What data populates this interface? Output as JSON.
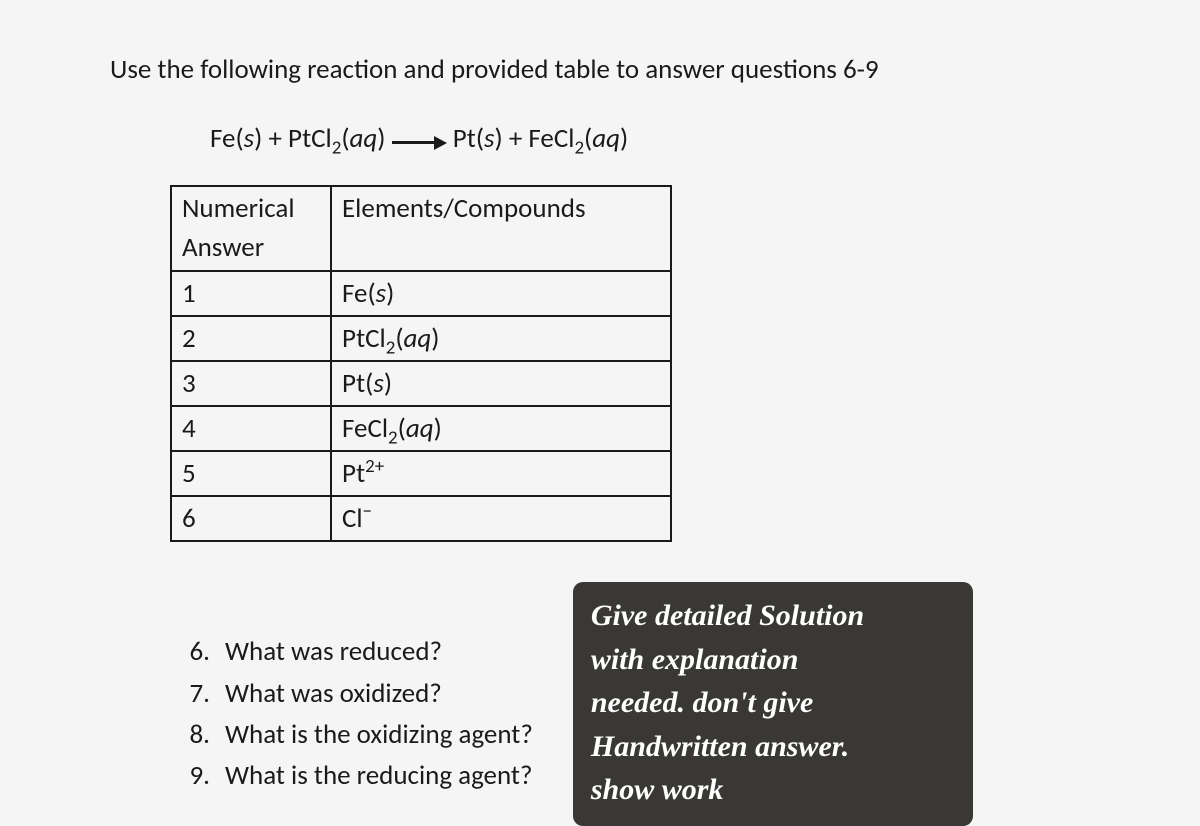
{
  "intro": "Use the following reaction and provided table to answer questions 6-9",
  "reaction": {
    "lhs1_el": "Fe",
    "lhs1_state": "s",
    "plus1": " + ",
    "lhs2_el": "PtCl",
    "lhs2_sub": "2",
    "lhs2_state": "aq",
    "rhs1_el": "Pt",
    "rhs1_state": "s",
    "plus2": " + ",
    "rhs2_el": "FeCl",
    "rhs2_sub": "2",
    "rhs2_state": "aq"
  },
  "table": {
    "header_col1": "Numerical Answer",
    "header_col2": "Elements/Compounds",
    "rows": [
      {
        "num": "1",
        "el": "Fe",
        "sub": "",
        "state": "s",
        "charge": ""
      },
      {
        "num": "2",
        "el": "PtCl",
        "sub": "2",
        "state": "aq",
        "charge": ""
      },
      {
        "num": "3",
        "el": "Pt",
        "sub": "",
        "state": "s",
        "charge": ""
      },
      {
        "num": "4",
        "el": "FeCl",
        "sub": "2",
        "state": "aq",
        "charge": ""
      },
      {
        "num": "5",
        "el": "Pt",
        "sub": "",
        "state": "",
        "charge": "2+"
      },
      {
        "num": "6",
        "el": "Cl",
        "sub": "",
        "state": "",
        "charge": "−"
      }
    ]
  },
  "questions": [
    {
      "n": "6.",
      "text": "What was reduced?"
    },
    {
      "n": "7.",
      "text": "What was oxidized?"
    },
    {
      "n": "8.",
      "text": "What is the oxidizing agent?"
    },
    {
      "n": "9.",
      "text": "What is the reducing agent?"
    }
  ],
  "note": {
    "line1": "Give detailed Solution",
    "line2": "with explanation",
    "line3": "needed. don't give",
    "line4": "Handwritten answer.",
    "line5": "show work"
  }
}
